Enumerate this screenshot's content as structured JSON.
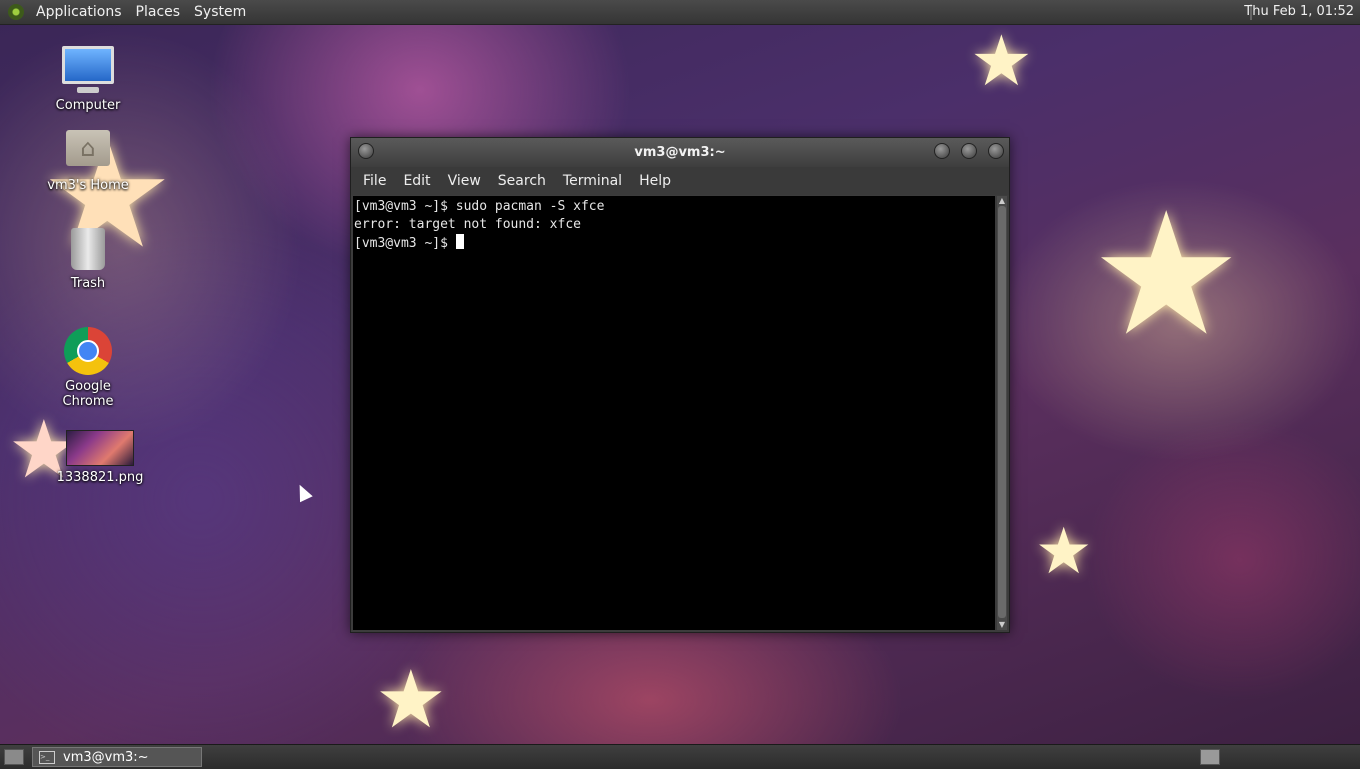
{
  "top_panel": {
    "menus": [
      "Applications",
      "Places",
      "System"
    ],
    "clock": "Thu Feb 1, 01:52"
  },
  "desktop_icons": [
    {
      "label": "Computer",
      "icon": "computer-icon"
    },
    {
      "label": "vm3's Home",
      "icon": "home-folder-icon"
    },
    {
      "label": "Trash",
      "icon": "trash-icon"
    },
    {
      "label": "Google Chrome",
      "icon": "chrome-icon"
    },
    {
      "label": "1338821.png",
      "icon": "image-file-icon"
    }
  ],
  "terminal": {
    "title": "vm3@vm3:~",
    "menu": [
      "File",
      "Edit",
      "View",
      "Search",
      "Terminal",
      "Help"
    ],
    "lines": [
      "[vm3@vm3 ~]$ sudo pacman -S xfce",
      "error: target not found: xfce",
      "[vm3@vm3 ~]$ "
    ]
  },
  "taskbar": {
    "task_label": "vm3@vm3:~"
  },
  "colors": {
    "panel": "#3f3f3f",
    "terminal_bg": "#000000",
    "terminal_fg": "#e6e6e6"
  }
}
